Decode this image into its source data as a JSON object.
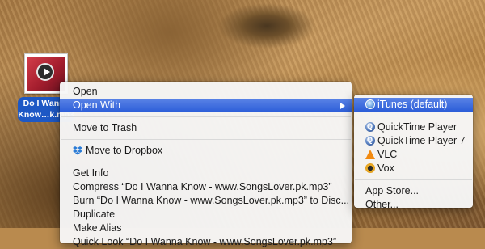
{
  "file": {
    "label_line1": "Do I Wanna",
    "label_line2": "Know…k.mp3"
  },
  "context_menu": {
    "open": "Open",
    "open_with": "Open With",
    "move_to_trash": "Move to Trash",
    "move_to_dropbox": "Move to Dropbox",
    "get_info": "Get Info",
    "compress": "Compress “Do I Wanna Know - www.SongsLover.pk.mp3”",
    "burn": "Burn “Do I Wanna Know - www.SongsLover.pk.mp3” to Disc...",
    "duplicate": "Duplicate",
    "make_alias": "Make Alias",
    "quick_look": "Quick Look “Do I Wanna Know - www.SongsLover.pk.mp3”"
  },
  "open_with_menu": {
    "itunes": "iTunes (default)",
    "quicktime": "QuickTime Player",
    "quicktime7": "QuickTime Player 7",
    "vlc": "VLC",
    "vox": "Vox",
    "app_store": "App Store...",
    "other": "Other..."
  },
  "icons": {
    "dropbox": "dropbox-icon",
    "itunes": "itunes-icon",
    "quicktime": "quicktime-icon",
    "vlc": "vlc-cone-icon",
    "vox": "vox-icon"
  },
  "colors": {
    "highlight": "#3d6ee0",
    "selection_label": "#1d58c5"
  }
}
